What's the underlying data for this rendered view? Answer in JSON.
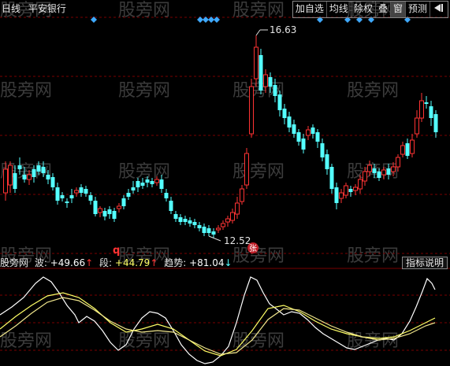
{
  "header": {
    "period": "日线",
    "stock": "平安银行"
  },
  "toolbar": {
    "items": [
      {
        "label": "加自选"
      },
      {
        "label": "均线"
      },
      {
        "label": "除权"
      },
      {
        "label": "叠"
      },
      {
        "label": "窗"
      },
      {
        "label": "预测"
      }
    ],
    "end_icon": "expand-arrow-icon"
  },
  "price_chart": {
    "high_label": "16.63",
    "low_label": "12.52",
    "low_marker": "q",
    "zhang_badge": "张",
    "colors": {
      "up": "#ff3333",
      "down": "#54ffff",
      "grid": "#7a0000",
      "diamond": "#3fa9ff"
    }
  },
  "indicator": {
    "name": "股旁网",
    "items": [
      {
        "label": "波:",
        "value": "+49.66",
        "arrow": "↑",
        "color": "#ffffff",
        "arrow_color": "#ff3333"
      },
      {
        "label": "段:",
        "value": "+44.79",
        "arrow": "↑",
        "color": "#ffff66",
        "arrow_color": "#ff3333"
      },
      {
        "label": "趋势:",
        "value": "+81.04",
        "arrow": "↓",
        "color": "#ffffff",
        "arrow_color": "#54ffff"
      }
    ],
    "button": "指标说明"
  },
  "watermark": "股旁网"
}
